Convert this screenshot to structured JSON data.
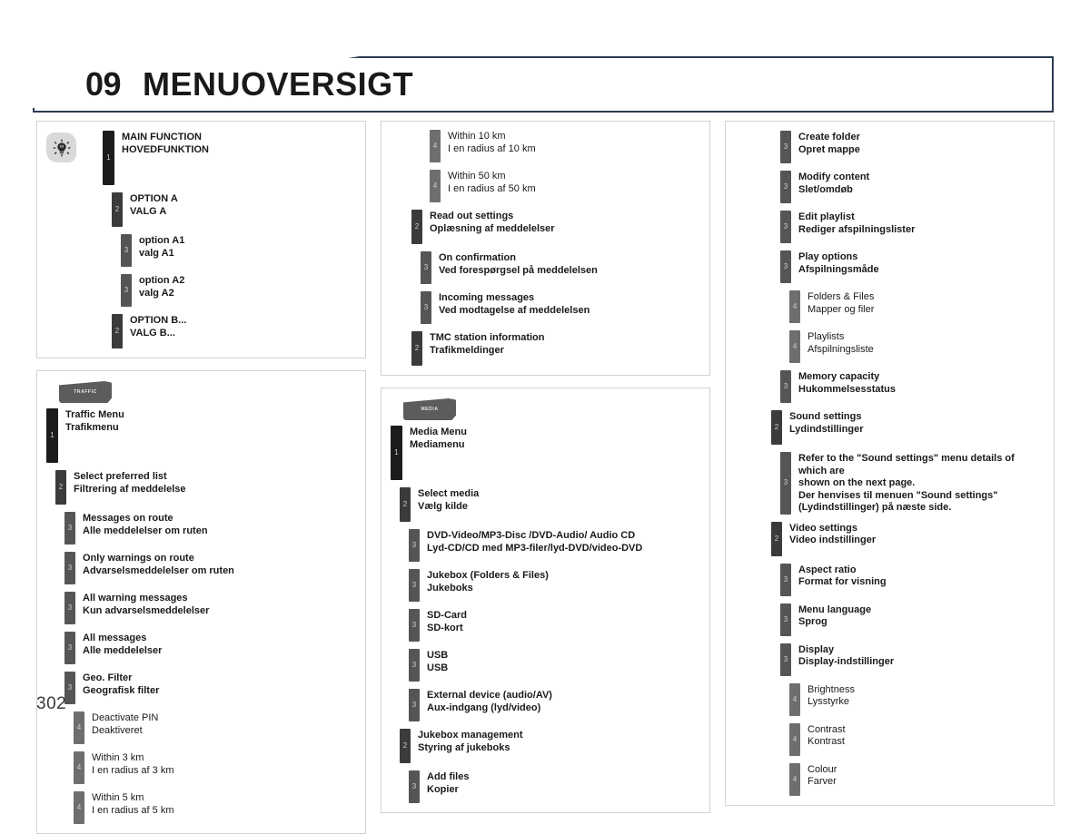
{
  "header": {
    "chapter_number": "09",
    "chapter_title": "MENUOVERSIGT"
  },
  "page_number": "302",
  "icons": {
    "main_function": "sun-lightbulb-icon",
    "traffic": "traffic-source-icon",
    "media": "media-source-icon"
  },
  "badges": {
    "traffic_label": "TRAFFIC",
    "media_label": "MEDIA"
  },
  "panels": {
    "legend": {
      "name": "legend-panel",
      "items": [
        {
          "level": 1,
          "en": "MAIN FUNCTION",
          "da": "HOVEDFUNKTION"
        },
        {
          "level": 2,
          "en": "OPTION A",
          "da": "VALG A"
        },
        {
          "level": 3,
          "en": "option A1",
          "da": "valg A1"
        },
        {
          "level": 3,
          "en": "option A2",
          "da": "valg A2"
        },
        {
          "level": 2,
          "en": "OPTION B...",
          "da": "VALG B..."
        }
      ]
    },
    "traffic": {
      "name": "traffic-menu-panel",
      "items": [
        {
          "level": 1,
          "en": "Traffic Menu",
          "da": "Trafikmenu"
        },
        {
          "level": 2,
          "en": "Select preferred list",
          "da": "Filtrering af meddelelse"
        },
        {
          "level": 3,
          "en": "Messages on route",
          "da": "Alle meddelelser om ruten"
        },
        {
          "level": 3,
          "en": "Only warnings on route",
          "da": "Advarselsmeddelelser om ruten"
        },
        {
          "level": 3,
          "en": "All warning messages",
          "da": "Kun advarselsmeddelelser"
        },
        {
          "level": 3,
          "en": "All messages",
          "da": "Alle meddelelser"
        },
        {
          "level": 3,
          "en": "Geo. Filter",
          "da": "Geografisk filter"
        },
        {
          "level": 4,
          "en": "Deactivate PIN",
          "da": "Deaktiveret"
        },
        {
          "level": 4,
          "en": "Within 3 km",
          "da": "I en radius af 3 km"
        },
        {
          "level": 4,
          "en": "Within 5 km",
          "da": "I en radius af 5 km"
        }
      ]
    },
    "traffic_continued": {
      "name": "traffic-menu-continued-panel",
      "items": [
        {
          "level": 4,
          "en": "Within 10 km",
          "da": "I en radius af 10 km"
        },
        {
          "level": 4,
          "en": "Within 50 km",
          "da": "I en radius af 50 km"
        },
        {
          "level": 2,
          "en": "Read out settings",
          "da": "Oplæsning af meddelelser"
        },
        {
          "level": 3,
          "en": "On confirmation",
          "da": "Ved forespørgsel på meddelelsen"
        },
        {
          "level": 3,
          "en": "Incoming messages",
          "da": "Ved modtagelse af meddelelsen"
        },
        {
          "level": 2,
          "en": "TMC station information",
          "da": "Trafikmeldinger"
        }
      ]
    },
    "media": {
      "name": "media-menu-panel",
      "items": [
        {
          "level": 1,
          "en": "Media Menu",
          "da": "Mediamenu"
        },
        {
          "level": 2,
          "en": "Select media",
          "da": "Vælg kilde"
        },
        {
          "level": 3,
          "en": "DVD-Video/MP3-Disc /DVD-Audio/ Audio CD",
          "da": "Lyd-CD/CD med MP3-filer/lyd-DVD/video-DVD"
        },
        {
          "level": 3,
          "en": "Jukebox (Folders & Files)",
          "da": "Jukeboks"
        },
        {
          "level": 3,
          "en": "SD-Card",
          "da": "SD-kort"
        },
        {
          "level": 3,
          "en": "USB",
          "da": "USB"
        },
        {
          "level": 3,
          "en": "External device (audio/AV)",
          "da": "Aux-indgang (lyd/video)"
        },
        {
          "level": 2,
          "en": "Jukebox management",
          "da": "Styring af jukeboks"
        },
        {
          "level": 3,
          "en": "Add files",
          "da": "Kopier"
        }
      ]
    },
    "media_continued": {
      "name": "media-menu-continued-panel",
      "items": [
        {
          "level": 3,
          "en": "Create folder",
          "da": "Opret mappe"
        },
        {
          "level": 3,
          "en": "Modify content",
          "da": "Slet/omdøb"
        },
        {
          "level": 3,
          "en": "Edit playlist",
          "da": "Rediger afspilningslister"
        },
        {
          "level": 3,
          "en": "Play options",
          "da": "Afspilningsmåde"
        },
        {
          "level": 4,
          "en": "Folders & Files",
          "da": "Mapper og filer"
        },
        {
          "level": 4,
          "en": "Playlists",
          "da": "Afspilningsliste"
        },
        {
          "level": 3,
          "en": "Memory capacity",
          "da": "Hukommelsesstatus"
        },
        {
          "level": 2,
          "en": "Sound settings",
          "da": "Lydindstillinger"
        },
        {
          "level": 3,
          "en": "Refer to the \"Sound settings\" menu details of which are\nshown on the next page.",
          "da": "Der henvises til menuen \"Sound settings\"\n(Lydindstillinger) på næste side."
        },
        {
          "level": 2,
          "en": "Video settings",
          "da": "Video indstillinger"
        },
        {
          "level": 3,
          "en": "Aspect ratio",
          "da": "Format for visning"
        },
        {
          "level": 3,
          "en": "Menu language",
          "da": "Sprog"
        },
        {
          "level": 3,
          "en": "Display",
          "da": "Display-indstillinger"
        },
        {
          "level": 4,
          "en": "Brightness",
          "da": "Lysstyrke"
        },
        {
          "level": 4,
          "en": "Contrast",
          "da": "Kontrast"
        },
        {
          "level": 4,
          "en": "Colour",
          "da": "Farver"
        }
      ]
    }
  }
}
